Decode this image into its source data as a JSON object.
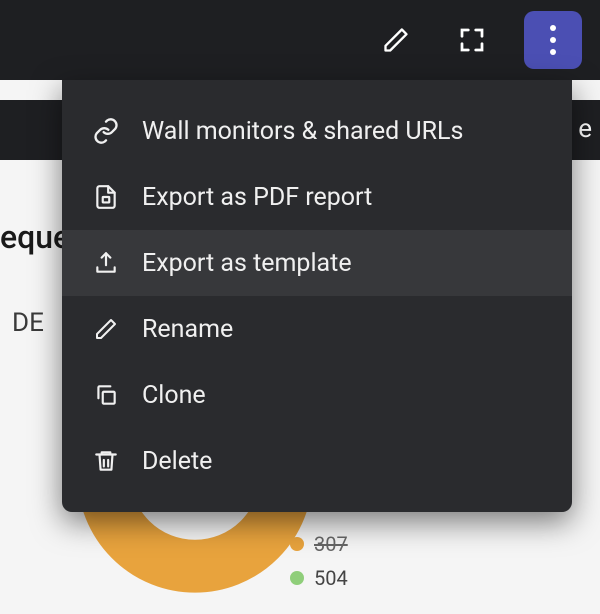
{
  "toolbar": {
    "edit_tooltip": "Edit",
    "fullscreen_tooltip": "Fullscreen",
    "more_tooltip": "More actions"
  },
  "page_fragments": {
    "title_partial": "eque",
    "subtitle_partial": "DE",
    "right_partial": "e"
  },
  "menu": {
    "items": [
      {
        "icon": "link-icon",
        "label": "Wall monitors & shared URLs"
      },
      {
        "icon": "pdf-icon",
        "label": "Export as PDF report"
      },
      {
        "icon": "export-icon",
        "label": "Export as template",
        "hovered": true
      },
      {
        "icon": "pencil-icon",
        "label": "Rename"
      },
      {
        "icon": "copy-icon",
        "label": "Clone"
      },
      {
        "icon": "trash-icon",
        "label": "Delete"
      }
    ]
  },
  "chart_data": {
    "type": "pie",
    "title": "",
    "legend": [
      {
        "label": "307",
        "color": "#e8a33d",
        "struck": true
      },
      {
        "label": "504",
        "color": "#8fce7a",
        "struck": false
      }
    ],
    "note": "donut chart partially obscured by menu"
  }
}
